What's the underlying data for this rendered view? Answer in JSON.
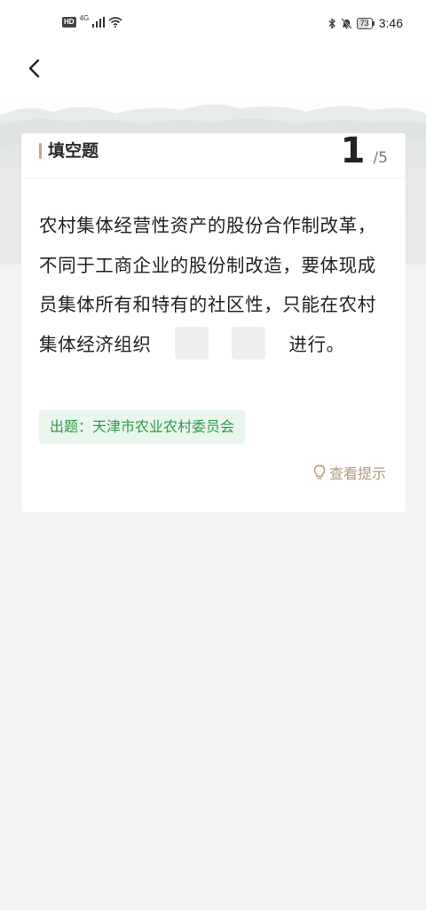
{
  "status_bar": {
    "hd_label": "HD",
    "network_type": "4G",
    "battery_level": "73",
    "time": "3:46"
  },
  "header": {
    "back_icon": "chevron-left-icon"
  },
  "card": {
    "question_type": "填空题",
    "progress_current": "1",
    "progress_total": "/5",
    "question_text_part1": "农村集体经营性资产的股份合作制改革，不同于工商企业的股份制改造，要体现成员集体所有和特有的社区性，只能在农村集体经济组织",
    "question_text_part2": "进行。",
    "blank_count": 2,
    "source_label": "出题：天津市农业农村委员会",
    "hint_label": "查看提示",
    "hint_icon": "lightbulb-icon"
  },
  "colors": {
    "accent": "#c7ab85",
    "source_text": "#2f9a4a",
    "source_bg": "#e9f6ec",
    "hint_text": "#b29a78"
  }
}
